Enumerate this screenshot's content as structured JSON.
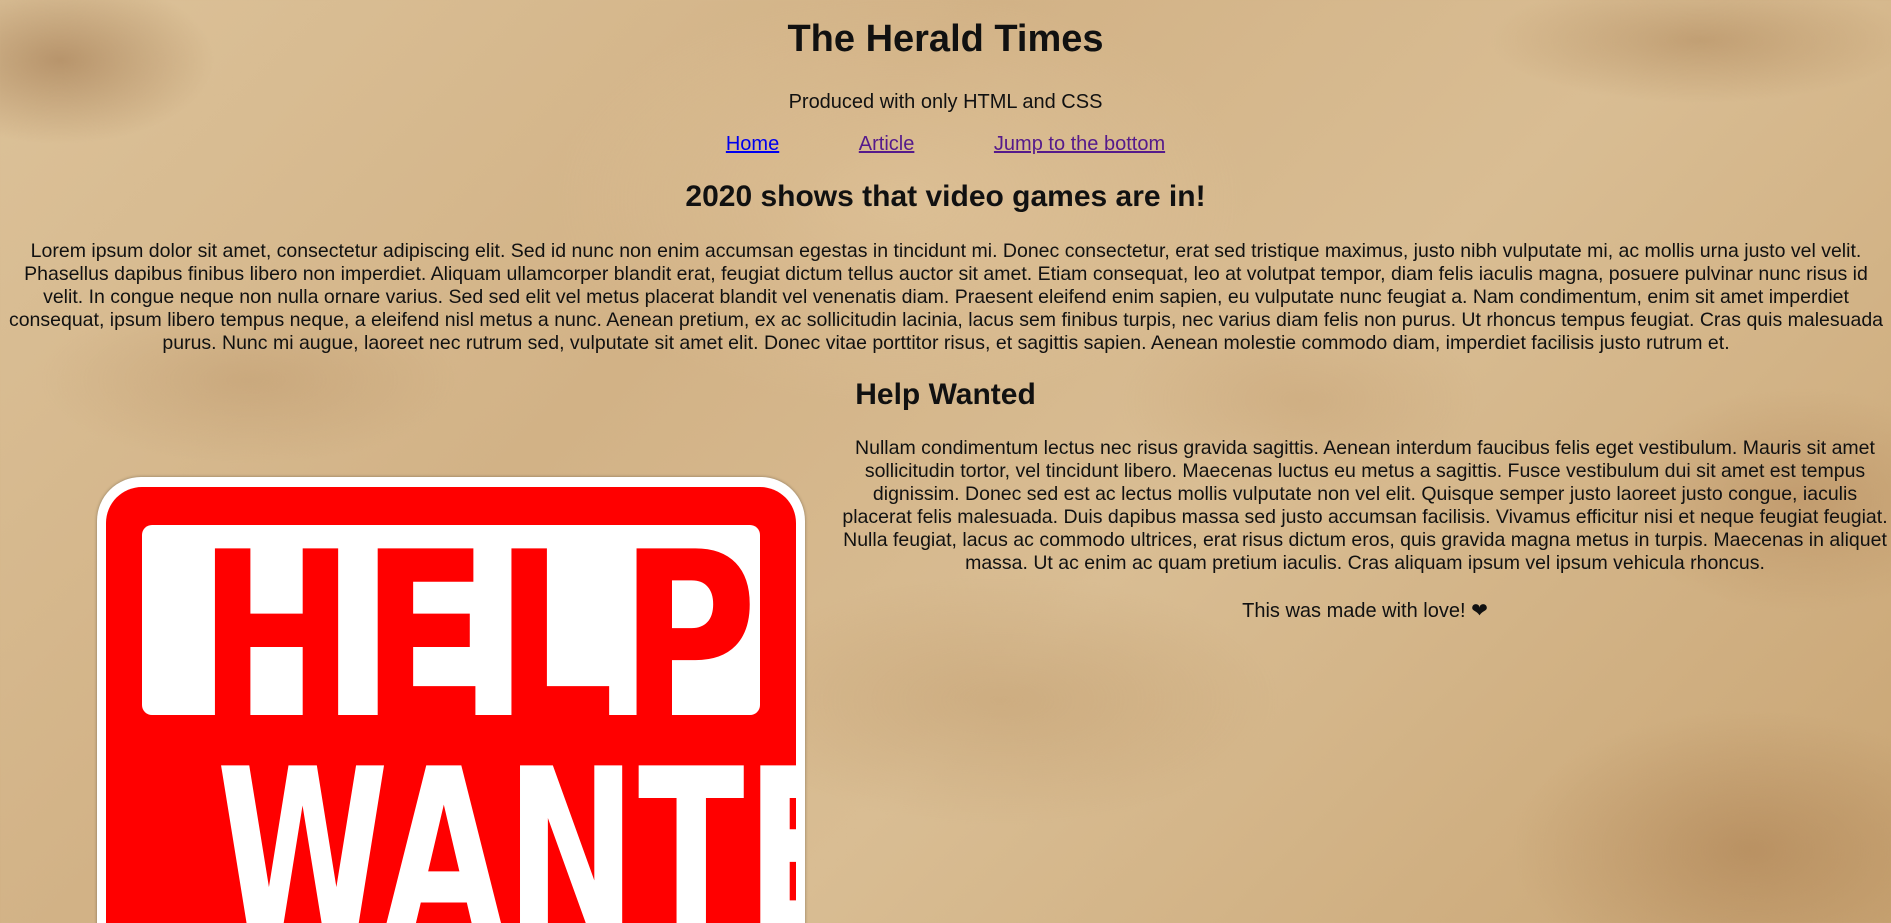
{
  "header": {
    "title": "The Herald Times",
    "tagline": "Produced with only HTML and CSS"
  },
  "nav": {
    "items": [
      {
        "label": "Home"
      },
      {
        "label": "Article"
      },
      {
        "label": "Jump to the bottom"
      }
    ]
  },
  "article": {
    "title": "2020 shows that video games are in!",
    "body": "Lorem ipsum dolor sit amet, consectetur adipiscing elit. Sed id nunc non enim accumsan egestas in tincidunt mi. Donec consectetur, erat sed tristique maximus, justo nibh vulputate mi, ac mollis urna justo vel velit. Phasellus dapibus finibus libero non imperdiet. Aliquam ullamcorper blandit erat, feugiat dictum tellus auctor sit amet. Etiam consequat, leo at volutpat tempor, diam felis iaculis magna, posuere pulvinar nunc risus id velit. In congue neque non nulla ornare varius. Sed sed elit vel metus placerat blandit vel venenatis diam. Praesent eleifend enim sapien, eu vulputate nunc feugiat a. Nam condimentum, enim sit amet imperdiet consequat, ipsum libero tempus neque, a eleifend nisl metus a nunc. Aenean pretium, ex ac sollicitudin lacinia, lacus sem finibus turpis, nec varius diam felis non purus. Ut rhoncus tempus feugiat. Cras quis malesuada purus. Nunc mi augue, laoreet nec rutrum sed, vulputate sit amet elit. Donec vitae porttitor risus, et sagittis sapien. Aenean molestie commodo diam, imperdiet facilisis justo rutrum et."
  },
  "help_wanted": {
    "title": "Help Wanted",
    "image_text_top": "HELP",
    "image_text_bottom": "WANTED",
    "body": "Nullam condimentum lectus nec risus gravida sagittis. Aenean interdum faucibus felis eget vestibulum. Mauris sit amet sollicitudin tortor, vel tincidunt libero. Maecenas luctus eu metus a sagittis. Fusce vestibulum dui sit amet est tempus dignissim. Donec sed est ac lectus mollis vulputate non vel elit. Quisque semper justo laoreet justo congue, iaculis placerat felis malesuada. Duis dapibus massa sed justo accumsan facilisis. Vivamus efficitur nisi et neque feugiat feugiat. Nulla feugiat, lacus ac commodo ultrices, erat risus dictum eros, quis gravida magna metus in turpis. Maecenas in aliquet massa. Ut ac enim ac quam pretium iaculis. Cras aliquam ipsum vel ipsum vehicula rhoncus.",
    "footer_note": "This was made with love! ❤"
  },
  "colors": {
    "link": "#0000ee",
    "visited_link": "#551a8b",
    "sign_red": "#ff0000",
    "parchment": "#d6b88f"
  }
}
